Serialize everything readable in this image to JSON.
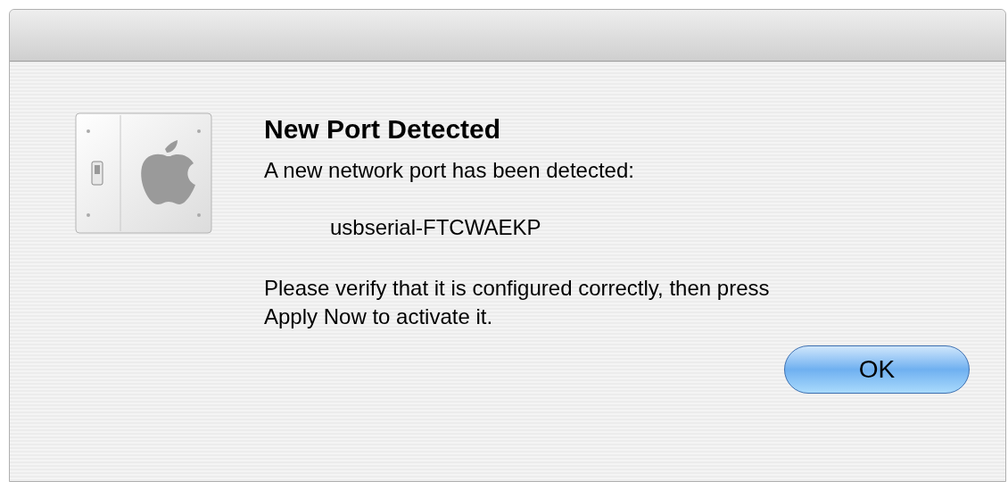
{
  "dialog": {
    "heading": "New Port Detected",
    "message": "A new network port has been detected:",
    "port_name": "usbserial-FTCWAEKP",
    "instructions": "Please verify that it is configured correctly, then press Apply Now to activate it.",
    "buttons": [
      {
        "label": "OK",
        "default": true
      }
    ]
  }
}
